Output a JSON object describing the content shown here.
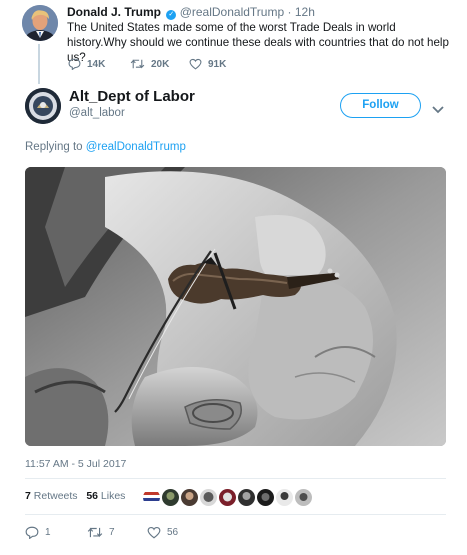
{
  "parent_tweet": {
    "name": "Donald J. Trump",
    "verified_glyph": "✓",
    "handle": "@realDonaldTrump",
    "separator": "·",
    "time": "12h",
    "text": "The United States made some of the worst Trade Deals in world history.Why should we continue these deals with countries that do not help us?",
    "replies": "14K",
    "retweets": "20K",
    "likes": "91K",
    "icons": {
      "reply": "reply-icon",
      "retweet": "retweet-icon",
      "like": "heart-icon"
    }
  },
  "tweet": {
    "name": "Alt_Dept of Labor",
    "handle": "@alt_labor",
    "follow_label": "Follow",
    "replying_prefix": "Replying to",
    "replying_to": "@realDonaldTrump",
    "timestamp": "11:57 AM - 5 Jul 2017",
    "retweet_count": "7",
    "retweet_label": "Retweets",
    "like_count": "56",
    "like_label": "Likes",
    "actions": {
      "replies": "1",
      "retweets": "7",
      "likes": "56"
    }
  },
  "colors": {
    "accent": "#1da1f2",
    "secondary_text": "#657786",
    "primary_text": "#14171a",
    "divider": "#e6ecf0"
  }
}
